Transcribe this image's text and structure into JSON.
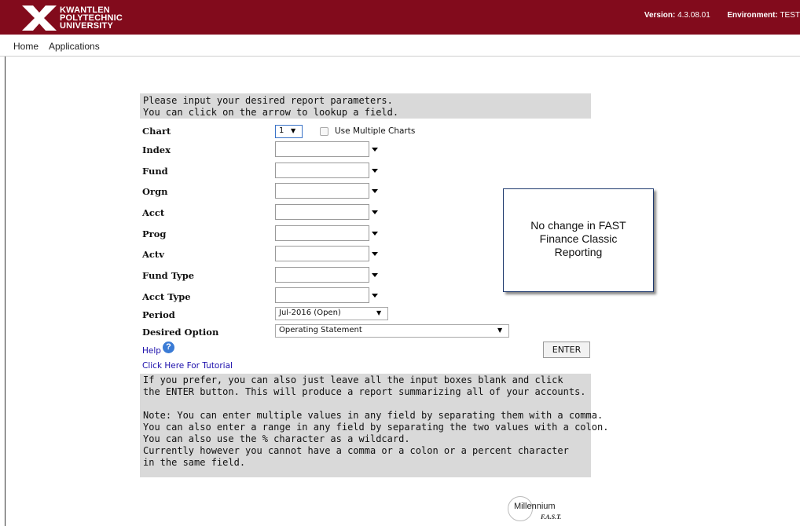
{
  "header": {
    "logo_line1": "KWANTLEN",
    "logo_line2": "POLYTECHNIC",
    "logo_line3": "UNIVERSITY",
    "version_label": "Version:",
    "version_value": "4.3.08.01",
    "environment_label": "Environment:",
    "environment_value": "TEST",
    "bar_color": "#820b1c"
  },
  "nav": {
    "home": "Home",
    "applications": "Applications"
  },
  "form": {
    "intro_line1": "Please input your desired report parameters.",
    "intro_line2": "You can click on the arrow to lookup a field.",
    "chart_label": "Chart",
    "chart_value": "1",
    "multi_charts_label": "Use Multiple Charts",
    "index_label": "Index",
    "fund_label": "Fund",
    "orgn_label": "Orgn",
    "acct_label": "Acct",
    "prog_label": "Prog",
    "actv_label": "Actv",
    "fund_type_label": "Fund Type",
    "acct_type_label": "Acct Type",
    "period_label": "Period",
    "period_value": "Jul-2016 (Open)",
    "option_label": "Desired Option",
    "option_value": "Operating Statement",
    "help_label": "Help",
    "tutorial_label": "Click Here For Tutorial",
    "enter_label": "ENTER"
  },
  "info": {
    "text": "If you prefer, you can also just leave all the input boxes blank and click\nthe ENTER button. This will produce a report summarizing all of your accounts.\n\nNote: You can enter multiple values in any field by separating them with a comma.\nYou can also enter a range in any field by separating the two values with a colon.\nYou can also use the % character as a wildcard.\nCurrently however you cannot have a comma or a colon or a percent character\nin the same field."
  },
  "callout": {
    "line1": "No change in FAST",
    "line2": "Finance Classic",
    "line3": "Reporting"
  },
  "footer": {
    "brand": "Millennium",
    "brand_sub": "F.A.S.T."
  }
}
